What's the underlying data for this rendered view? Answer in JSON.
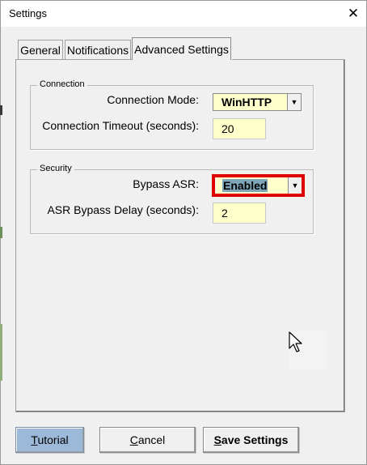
{
  "window": {
    "title": "Settings"
  },
  "tabs": [
    {
      "label": "General"
    },
    {
      "label": "Notifications"
    },
    {
      "label": "Advanced Settings",
      "active": true
    }
  ],
  "connection": {
    "legend": "Connection",
    "mode_label": "Connection Mode:",
    "mode_value": "WinHTTP",
    "timeout_label": "Connection Timeout (seconds):",
    "timeout_value": "20"
  },
  "security": {
    "legend": "Security",
    "bypass_label": "Bypass ASR:",
    "bypass_value": "Enabled",
    "delay_label": "ASR Bypass Delay (seconds):",
    "delay_value": "2"
  },
  "buttons": {
    "tutorial_accel": "T",
    "tutorial_rest": "utorial",
    "cancel_accel": "C",
    "cancel_rest": "ancel",
    "save_accel": "S",
    "save_rest": "ave Settings"
  },
  "colors": {
    "field_background": "#ffffcc",
    "highlight_border": "#e00000",
    "selection": "#7fa6b8",
    "primary_button": "#9db9d9"
  }
}
